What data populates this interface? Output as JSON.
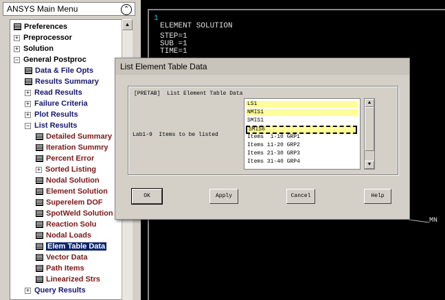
{
  "menu": {
    "title": "ANSYS Main Menu",
    "collapse_icon": "double-chevron-up-icon",
    "items": [
      {
        "label": "Preferences",
        "icon": "doc"
      },
      {
        "label": "Preprocessor",
        "icon": "plus"
      },
      {
        "label": "Solution",
        "icon": "plus"
      },
      {
        "label": "General Postproc",
        "icon": "minus"
      },
      {
        "label": "Data & File Opts",
        "icon": "doc"
      },
      {
        "label": "Results Summary",
        "icon": "doc"
      },
      {
        "label": "Read Results",
        "icon": "plus"
      },
      {
        "label": "Failure Criteria",
        "icon": "plus"
      },
      {
        "label": "Plot Results",
        "icon": "plus"
      },
      {
        "label": "List Results",
        "icon": "minus"
      },
      {
        "label": "Detailed Summary",
        "icon": "doc"
      },
      {
        "label": "Iteration Summry",
        "icon": "doc"
      },
      {
        "label": "Percent Error",
        "icon": "doc"
      },
      {
        "label": "Sorted Listing",
        "icon": "plus"
      },
      {
        "label": "Nodal Solution",
        "icon": "doc"
      },
      {
        "label": "Element Solution",
        "icon": "doc"
      },
      {
        "label": "Superelem DOF",
        "icon": "doc"
      },
      {
        "label": "SpotWeld Solution",
        "icon": "doc"
      },
      {
        "label": "Reaction Solu",
        "icon": "doc"
      },
      {
        "label": "Nodal Loads",
        "icon": "doc"
      },
      {
        "label": "Elem Table Data",
        "icon": "doc"
      },
      {
        "label": "Vector Data",
        "icon": "doc"
      },
      {
        "label": "Path Items",
        "icon": "doc"
      },
      {
        "label": "Linearized Strs",
        "icon": "doc"
      },
      {
        "label": "Query Results",
        "icon": "plus"
      }
    ]
  },
  "graphics": {
    "window_number": "1",
    "heading": "ELEMENT SOLUTION",
    "lines": [
      "STEP=1",
      "SUB =1",
      "TIME=1"
    ],
    "mn_label": "MN"
  },
  "dialog": {
    "title": "List Element Table Data",
    "group_header": "[PRETAB]  List Element Table Data",
    "field_label": "Lab1-9  Items to be listed",
    "list_items": [
      "LS1",
      "NMIS1",
      "SMIS1",
      "SMIS6",
      "Items  1-10 GRP1",
      "Items 11-20 GRP2",
      "Items 21-30 GRP3",
      "Items 31-40 GRP4"
    ],
    "selected_flags": [
      true,
      true,
      false,
      true,
      false,
      false,
      false,
      false
    ],
    "buttons": {
      "ok": "OK",
      "apply": "Apply",
      "cancel": "Cancel",
      "help": "Help"
    }
  }
}
